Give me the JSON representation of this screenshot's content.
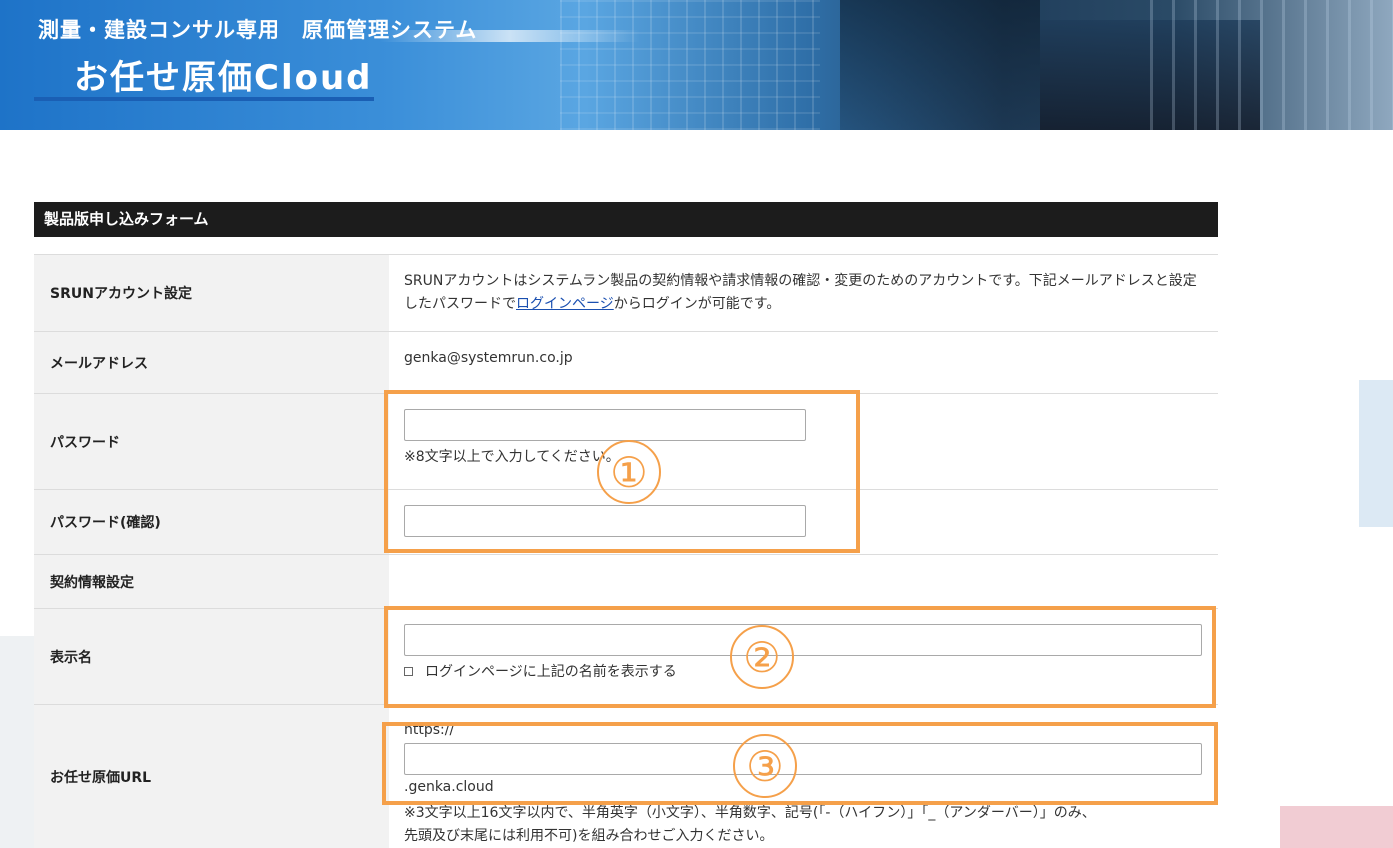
{
  "header": {
    "subtitle": "測量・建設コンサル専用　原価管理システム",
    "title": "お任せ原価Cloud"
  },
  "form": {
    "title": "製品版申し込みフォーム",
    "rows": {
      "account": {
        "label": "SRUNアカウント設定",
        "desc_before": "SRUNアカウントはシステムラン製品の契約情報や請求情報の確認・変更のためのアカウントです。下記メールアドレスと設定したパスワードで",
        "link": "ログインページ",
        "desc_after": "からログインが可能です。"
      },
      "email": {
        "label": "メールアドレス",
        "value": "genka@systemrun.co.jp"
      },
      "password": {
        "label": "パスワード",
        "value": "",
        "note": "※8文字以上で入力してください。"
      },
      "password_confirm": {
        "label": "パスワード(確認)",
        "value": ""
      },
      "contract": {
        "label": "契約情報設定"
      },
      "display_name": {
        "label": "表示名",
        "value": "",
        "checkbox_label": "ログインページに上記の名前を表示する",
        "checked": false
      },
      "url": {
        "label": "お任せ原価URL",
        "prefix": "https://",
        "value": "",
        "suffix": ".genka.cloud",
        "note1": "※3文字以上16文字以内で、半角英字（小文字）、半角数字、記号(「-（ハイフン）」「_（アンダーバー）」のみ、",
        "note2": "先頭及び末尾には利用不可)を組み合わせご入力ください。"
      }
    }
  },
  "annotations": [
    "①",
    "②",
    "③"
  ],
  "colors": {
    "accent_orange": "#f5a04a",
    "header_bar": "#1c1c1c",
    "label_bg": "#f2f2f2",
    "link": "#1a4fb0"
  }
}
